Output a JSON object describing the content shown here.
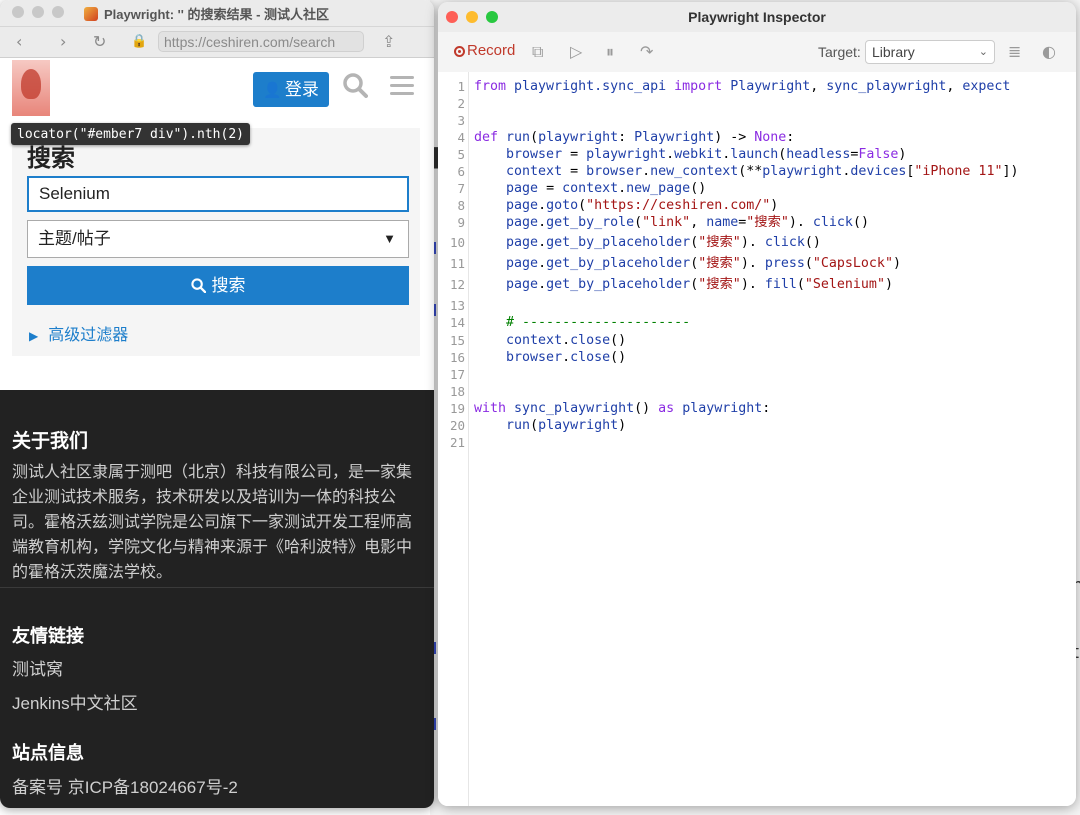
{
  "browser": {
    "title": "Playwright: '' 的搜索结果 - 测试人社区",
    "url": "https://ceshiren.com/search",
    "login_label": "登录",
    "tooltip": "locator(\"#ember7 div\").nth(2)",
    "search_heading": "搜索",
    "search_value": "Selenium",
    "search_scope": "主题/帖子",
    "search_button": "搜索",
    "advanced_filters": "高级过滤器"
  },
  "footer": {
    "about_title": "关于我们",
    "about_text": "测试人社区隶属于测吧（北京）科技有限公司，是一家集企业测试技术服务，技术研发以及培训为一体的科技公司。霍格沃兹测试学院是公司旗下一家测试开发工程师高端教育机构，学院文化与精神来源于《哈利波特》电影中的霍格沃茨魔法学校。",
    "links_title": "友情链接",
    "links": [
      "测试窝",
      "Jenkins中文社区"
    ],
    "site_title": "站点信息",
    "icp": "备案号 京ICP备18024667号-2"
  },
  "inspector": {
    "title": "Playwright Inspector",
    "record_label": "Record",
    "target_label": "Target:",
    "target_value": "Library",
    "lines": [
      [
        [
          "k",
          "from "
        ],
        [
          "v",
          "playwright.sync_api "
        ],
        [
          "k",
          "import "
        ],
        [
          "v",
          "Playwright"
        ],
        [
          "p",
          ", "
        ],
        [
          "v",
          "sync_playwright"
        ],
        [
          "p",
          ", "
        ],
        [
          "v",
          "expect"
        ]
      ],
      [],
      [],
      [
        [
          "k",
          "def "
        ],
        [
          "v",
          "run"
        ],
        [
          "p",
          "("
        ],
        [
          "v",
          "playwright"
        ],
        [
          "p",
          ": "
        ],
        [
          "v",
          "Playwright"
        ],
        [
          "p",
          ") -> "
        ],
        [
          "k",
          "None"
        ],
        [
          "p",
          ":"
        ]
      ],
      [
        [
          "p",
          "    "
        ],
        [
          "v",
          "browser "
        ],
        [
          "p",
          "= "
        ],
        [
          "v",
          "playwright"
        ],
        [
          "p",
          "."
        ],
        [
          "v",
          "webkit"
        ],
        [
          "p",
          "."
        ],
        [
          "v",
          "launch"
        ],
        [
          "p",
          "("
        ],
        [
          "v",
          "headless"
        ],
        [
          "p",
          "="
        ],
        [
          "k",
          "False"
        ],
        [
          "p",
          ")"
        ]
      ],
      [
        [
          "p",
          "    "
        ],
        [
          "v",
          "context "
        ],
        [
          "p",
          "= "
        ],
        [
          "v",
          "browser"
        ],
        [
          "p",
          "."
        ],
        [
          "v",
          "new_context"
        ],
        [
          "p",
          "(**"
        ],
        [
          "v",
          "playwright"
        ],
        [
          "p",
          "."
        ],
        [
          "v",
          "devices"
        ],
        [
          "p",
          "["
        ],
        [
          "s",
          "\"iPhone 11\""
        ],
        [
          "p",
          "])"
        ]
      ],
      [
        [
          "p",
          "    "
        ],
        [
          "v",
          "page "
        ],
        [
          "p",
          "= "
        ],
        [
          "v",
          "context"
        ],
        [
          "p",
          "."
        ],
        [
          "v",
          "new_page"
        ],
        [
          "p",
          "()"
        ]
      ],
      [
        [
          "p",
          "    "
        ],
        [
          "v",
          "page"
        ],
        [
          "p",
          "."
        ],
        [
          "v",
          "goto"
        ],
        [
          "p",
          "("
        ],
        [
          "s",
          "\"https://ceshiren.com/\""
        ],
        [
          "p",
          ")"
        ]
      ],
      [
        [
          "p",
          "    "
        ],
        [
          "v",
          "page"
        ],
        [
          "p",
          "."
        ],
        [
          "v",
          "get_by_role"
        ],
        [
          "p",
          "("
        ],
        [
          "s",
          "\"link\""
        ],
        [
          "p",
          ", "
        ],
        [
          "v",
          "name"
        ],
        [
          "p",
          "="
        ],
        [
          "s",
          "\"搜索\""
        ],
        [
          "p",
          "). "
        ],
        [
          "v",
          "click"
        ],
        [
          "p",
          "()"
        ]
      ],
      [
        [
          "p",
          "    "
        ],
        [
          "v",
          "page"
        ],
        [
          "p",
          "."
        ],
        [
          "v",
          "get_by_placeholder"
        ],
        [
          "p",
          "("
        ],
        [
          "s",
          "\"搜索\""
        ],
        [
          "p",
          "). "
        ],
        [
          "v",
          "click"
        ],
        [
          "p",
          "()"
        ]
      ],
      [
        [
          "p",
          "    "
        ],
        [
          "v",
          "page"
        ],
        [
          "p",
          "."
        ],
        [
          "v",
          "get_by_placeholder"
        ],
        [
          "p",
          "("
        ],
        [
          "s",
          "\"搜索\""
        ],
        [
          "p",
          "). "
        ],
        [
          "v",
          "press"
        ],
        [
          "p",
          "("
        ],
        [
          "s",
          "\"CapsLock\""
        ],
        [
          "p",
          ")"
        ]
      ],
      [
        [
          "p",
          "    "
        ],
        [
          "v",
          "page"
        ],
        [
          "p",
          "."
        ],
        [
          "v",
          "get_by_placeholder"
        ],
        [
          "p",
          "("
        ],
        [
          "s",
          "\"搜索\""
        ],
        [
          "p",
          "). "
        ],
        [
          "v",
          "fill"
        ],
        [
          "p",
          "("
        ],
        [
          "s",
          "\"Selenium\""
        ],
        [
          "p",
          ")"
        ]
      ],
      [],
      [
        [
          "p",
          "    "
        ],
        [
          "c",
          "# ---------------------"
        ]
      ],
      [
        [
          "p",
          "    "
        ],
        [
          "v",
          "context"
        ],
        [
          "p",
          "."
        ],
        [
          "v",
          "close"
        ],
        [
          "p",
          "()"
        ]
      ],
      [
        [
          "p",
          "    "
        ],
        [
          "v",
          "browser"
        ],
        [
          "p",
          "."
        ],
        [
          "v",
          "close"
        ],
        [
          "p",
          "()"
        ]
      ],
      [],
      [],
      [
        [
          "k",
          "with "
        ],
        [
          "v",
          "sync_playwright"
        ],
        [
          "p",
          "() "
        ],
        [
          "k",
          "as "
        ],
        [
          "v",
          "playwright"
        ],
        [
          "p",
          ":"
        ]
      ],
      [
        [
          "p",
          "    "
        ],
        [
          "v",
          "run"
        ],
        [
          "p",
          "("
        ],
        [
          "v",
          "playwright"
        ],
        [
          "p",
          ")"
        ]
      ],
      []
    ]
  },
  "colors": {
    "accent": "#1d7ecb",
    "record": "#c0392b",
    "footer_bg": "#222222"
  }
}
